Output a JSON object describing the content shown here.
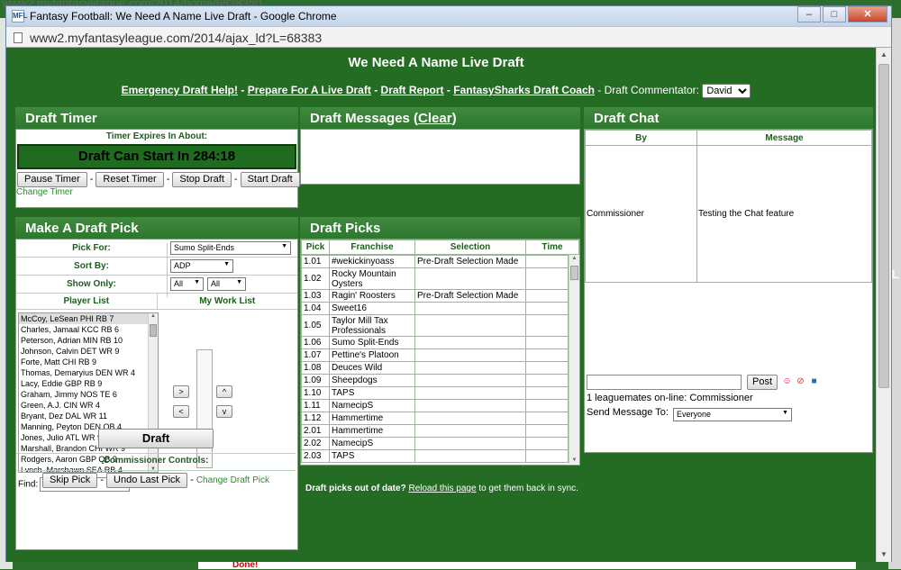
{
  "background": {
    "url_fragment": "www2.myfantasyleague.com/2014/home/68383#0",
    "done_text": "Done!",
    "edge_letter": "L"
  },
  "window": {
    "app_icon_text": "MFL",
    "title": "Fantasy Football: We Need A Name Live Draft - Google Chrome",
    "url": "www2.myfantasyleague.com/2014/ajax_ld?L=68383"
  },
  "page": {
    "title": "We Need A Name Live Draft",
    "links": [
      "Emergency Draft Help!",
      "Prepare For A Live Draft",
      "Draft Report",
      "FantasySharks Draft Coach"
    ],
    "separator": "-",
    "commentator_label": "- Draft Commentator:",
    "commentator_value": "David"
  },
  "timer": {
    "heading": "Draft Timer",
    "expires_label": "Timer Expires In About:",
    "display": "Draft Can Start In 284:18",
    "buttons": [
      "Pause Timer",
      "Reset Timer",
      "Stop Draft",
      "Start Draft"
    ],
    "change_link": "Change Timer"
  },
  "messages": {
    "heading": "Draft Messages (",
    "clear_link": "Clear",
    "heading_close": ")"
  },
  "chat": {
    "heading": "Draft Chat",
    "col_by": "By",
    "col_message": "Message",
    "rows": [
      {
        "by": "Commissioner",
        "message": "Testing the Chat feature"
      }
    ],
    "post_label": "Post",
    "online_text": "1 leaguemates on-line: Commissioner",
    "send_to_label": "Send Message To:",
    "send_to_value": "Everyone"
  },
  "make_pick": {
    "heading": "Make A Draft Pick",
    "pick_for_label": "Pick For:",
    "pick_for_value": "Sumo Split-Ends",
    "sort_by_label": "Sort By:",
    "sort_by_value": "ADP",
    "show_only_label": "Show Only:",
    "show_only_value_1": "All",
    "show_only_value_2": "All",
    "player_list_label": "Player List",
    "work_list_label": "My Work List",
    "players": [
      "McCoy, LeSean PHI RB 7",
      "Charles, Jamaal KCC RB 6",
      "Peterson, Adrian MIN RB 10",
      "Johnson, Calvin DET WR 9",
      "Forte, Matt CHI RB 9",
      "Thomas, Demaryius DEN WR 4",
      "Lacy, Eddie GBP RB 9",
      "Graham, Jimmy NOS TE 6",
      "Green, A.J. CIN WR 4",
      "Bryant, Dez DAL WR 11",
      "Manning, Peyton DEN QB 4",
      "Jones, Julio ATL WR 9",
      "Marshall, Brandon CHI WR 9",
      "Rodgers, Aaron GBP QB 9",
      "Lynch, Marshawn SEA RB 4"
    ],
    "add_btn": ">",
    "remove_btn": "<",
    "up_btn": "^",
    "down_btn": "v",
    "find_label": "Find:",
    "draft_btn": "Draft",
    "commissioner_label": "Commissioner Controls:",
    "skip_btn": "Skip Pick",
    "undo_btn": "Undo Last Pick",
    "change_pick_link": "Change Draft Pick"
  },
  "picks": {
    "heading": "Draft Picks",
    "columns": [
      "Pick",
      "Franchise",
      "Selection",
      "Time"
    ],
    "rows": [
      {
        "pick": "1.01",
        "franchise": "#wekickinyoass",
        "selection": "Pre-Draft Selection Made",
        "time": ""
      },
      {
        "pick": "1.02",
        "franchise": "Rocky Mountain Oysters",
        "selection": "",
        "time": ""
      },
      {
        "pick": "1.03",
        "franchise": "Ragin' Roosters",
        "selection": "Pre-Draft Selection Made",
        "time": ""
      },
      {
        "pick": "1.04",
        "franchise": "Sweet16",
        "selection": "",
        "time": ""
      },
      {
        "pick": "1.05",
        "franchise": "Taylor Mill Tax Professionals",
        "selection": "",
        "time": ""
      },
      {
        "pick": "1.06",
        "franchise": "Sumo Split-Ends",
        "selection": "",
        "time": ""
      },
      {
        "pick": "1.07",
        "franchise": "Pettine's Platoon",
        "selection": "",
        "time": ""
      },
      {
        "pick": "1.08",
        "franchise": "Deuces Wild",
        "selection": "",
        "time": ""
      },
      {
        "pick": "1.09",
        "franchise": "Sheepdogs",
        "selection": "",
        "time": ""
      },
      {
        "pick": "1.10",
        "franchise": "TAPS",
        "selection": "",
        "time": ""
      },
      {
        "pick": "1.11",
        "franchise": "NamecipS",
        "selection": "",
        "time": ""
      },
      {
        "pick": "1.12",
        "franchise": "Hammertime",
        "selection": "",
        "time": ""
      },
      {
        "pick": "2.01",
        "franchise": "Hammertime",
        "selection": "",
        "time": ""
      },
      {
        "pick": "2.02",
        "franchise": "NamecipS",
        "selection": "",
        "time": ""
      },
      {
        "pick": "2.03",
        "franchise": "TAPS",
        "selection": "",
        "time": ""
      }
    ],
    "out_of_date_bold": "Draft picks out of date?",
    "reload_link": "Reload this page",
    "out_of_date_rest": "to get them back in sync."
  },
  "colors": {
    "page_green": "#246b24",
    "panel_header_green": "#3f8a3f",
    "label_green": "#1d5e1d"
  }
}
